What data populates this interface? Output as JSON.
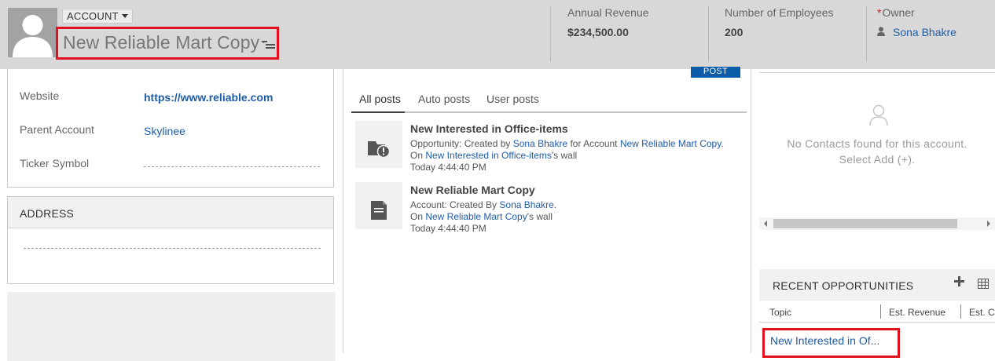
{
  "header": {
    "entity_type": "ACCOUNT",
    "record_title": "New Reliable Mart Copy",
    "fields": [
      {
        "label": "Annual Revenue",
        "value": "$234,500.00"
      },
      {
        "label": "Number of Employees",
        "value": "200"
      }
    ],
    "owner": {
      "required_mark": "*",
      "label": "Owner",
      "value": "Sona Bhakre"
    }
  },
  "details": {
    "website": {
      "label": "Website",
      "value": "https://www.reliable.com"
    },
    "parent_account": {
      "label": "Parent Account",
      "value": "Skylinee"
    },
    "ticker_symbol": {
      "label": "Ticker Symbol",
      "value": ""
    }
  },
  "address": {
    "title": "ADDRESS"
  },
  "posts": {
    "post_button": "POST",
    "tabs": [
      "All posts",
      "Auto posts",
      "User posts"
    ],
    "items": [
      {
        "title": "New Interested in Office-items",
        "line1_prefix": "Opportunity: Created by ",
        "line1_user": "Sona Bhakre",
        "line1_mid": " for Account ",
        "line1_account": "New Reliable Mart Copy",
        "line1_suffix": ".",
        "line2_prefix": "On ",
        "line2_link": "New Interested in Office-items",
        "line2_suffix": "'s wall",
        "time": "Today 4:44:40 PM"
      },
      {
        "title": "New Reliable Mart Copy",
        "line1_prefix": "Account: Created By ",
        "line1_user": "Sona Bhakre",
        "line1_suffix": ".",
        "line2_prefix": "On ",
        "line2_link": "New Reliable Mart Copy",
        "line2_suffix": "'s wall",
        "time": "Today 4:44:40 PM"
      }
    ]
  },
  "contacts": {
    "empty_line1": "No Contacts found for this account.",
    "empty_line2": "Select Add (+)."
  },
  "opportunities": {
    "title": "RECENT OPPORTUNITIES",
    "columns": [
      "Topic",
      "Est. Revenue",
      "Est. Cl"
    ],
    "rows": [
      {
        "topic": "New Interested in Of..."
      }
    ]
  },
  "colors": {
    "header_bg": "#d8d8d8",
    "link": "#1e5ca8",
    "highlight": "#e2111d",
    "post_button": "#0a5ba8"
  }
}
